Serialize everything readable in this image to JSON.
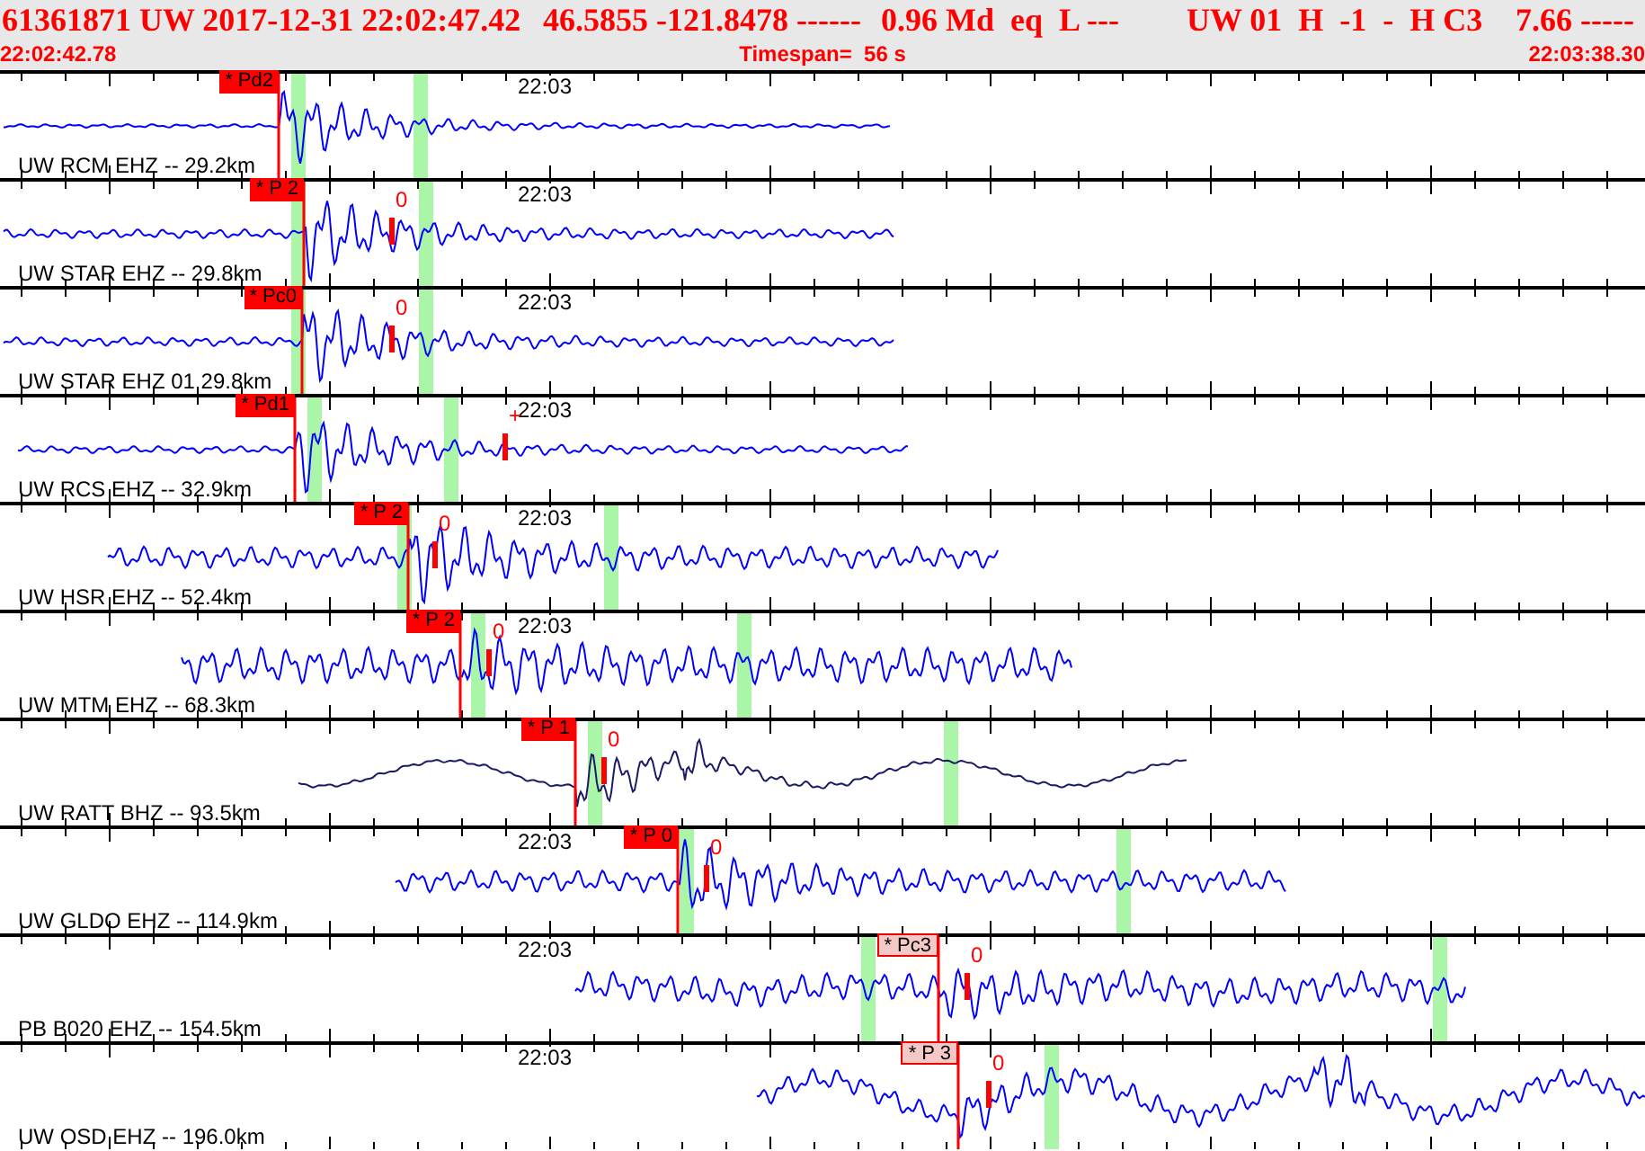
{
  "header": {
    "fields": [
      "61361871 UW 2017-12-31 22:02:47.42",
      "46.5855 -121.8478 ------",
      "0.96 Md  eq  L ---",
      "UW 01  H  -1  -  H C3",
      "7.66 -----"
    ],
    "start_time": "22:02:42.78",
    "timespan": "Timespan=  56 s",
    "end_time": "22:03:38.30"
  },
  "traces": [
    {
      "label": "UW RCM EHZ -- 29.2km",
      "time_label": "22:03",
      "pick": {
        "label": "* Pd2",
        "kind": "solid"
      },
      "color": "#0000ff"
    },
    {
      "label": "UW STAR EHZ -- 29.8km",
      "time_label": "22:03",
      "pick": {
        "label": "* P 2",
        "kind": "solid"
      },
      "marker": "0",
      "color": "#0000ff"
    },
    {
      "label": "UW STAR EHZ 01 29.8km",
      "time_label": "22:03",
      "pick": {
        "label": "* Pc0",
        "kind": "solid"
      },
      "marker": "0",
      "color": "#0000ff"
    },
    {
      "label": "UW RCS EHZ -- 32.9km",
      "time_label": "22:03",
      "pick": {
        "label": "* Pd1",
        "kind": "solid"
      },
      "marker": "+",
      "color": "#0000ff"
    },
    {
      "label": "UW HSR EHZ -- 52.4km",
      "time_label": "22:03",
      "pick": {
        "label": "* P 2",
        "kind": "solid"
      },
      "marker": "0",
      "color": "#0000ff"
    },
    {
      "label": "UW MTM EHZ -- 68.3km",
      "time_label": "22:03",
      "pick": {
        "label": "* P 2",
        "kind": "solid"
      },
      "marker": "0",
      "color": "#0000ff"
    },
    {
      "label": "UW RATT BHZ -- 93.5km",
      "pick": {
        "label": "* P 1",
        "kind": "solid"
      },
      "marker": "0",
      "color": "#1a1a66"
    },
    {
      "label": "UW GLDO EHZ -- 114.9km",
      "time_label": "22:03",
      "pick": {
        "label": "* P 0",
        "kind": "solid"
      },
      "marker": "0",
      "color": "#0000ff"
    },
    {
      "label": "PB B020 EHZ -- 154.5km",
      "time_label": "22:03",
      "pick": {
        "label": "* Pc3",
        "kind": "faded"
      },
      "marker": "0",
      "color": "#0000ff"
    },
    {
      "label": "UW OSD EHZ -- 196.0km",
      "time_label": "22:03",
      "pick": {
        "label": "* P 3",
        "kind": "faded"
      },
      "marker": "0",
      "color": "#0000ff"
    }
  ]
}
